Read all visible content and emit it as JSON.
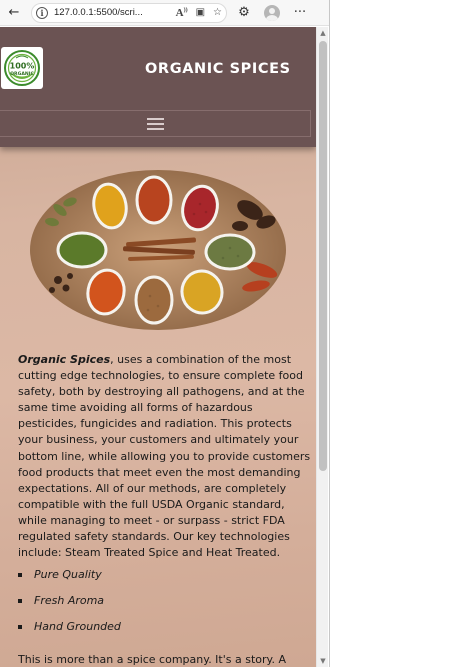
{
  "browser": {
    "url": "127.0.0.1:5500/scri...",
    "icons": {
      "back": "back-arrow-icon",
      "info": "info-icon",
      "reader": "read-aloud-icon",
      "immersive": "immersive-reader-icon",
      "favorite": "add-favorite-icon",
      "extensions": "extensions-icon",
      "profile": "profile-avatar-icon",
      "menu": "more-menu-icon"
    },
    "glyphs": {
      "back": "←",
      "info": "i",
      "reader": "Aᴬ",
      "immersive": "▣",
      "favorite": "☆",
      "extensions": "⚙",
      "menu": "···"
    }
  },
  "site": {
    "logo_top": "100%",
    "logo_bottom": "ORGANIC",
    "title": "ORGANIC SPICES",
    "colors": {
      "header": "#6b5353",
      "text": "#1a1a1a"
    }
  },
  "content": {
    "brand": "Organic Spices",
    "intro_rest": ", uses a combination of the most cutting edge technologies, to ensure complete food safety, both by destroying all pathogens, and at the same time avoiding all forms of hazardous pesticides, fungicides and radiation. This protects your business, your customers and ultimately your bottom line, while allowing you to provide customers food products that meet even the most demanding expectations. All of our methods, are completely compatible with the full USDA Organic standard, while managing to meet - or surpass - strict FDA regulated safety standards. Our key technologies include: Steam Treated Spice and Heat Treated.",
    "features": [
      "Pure Quality",
      "Fresh Aroma",
      "Hand Grounded"
    ],
    "story": "This is more than a spice company. It's a story. A"
  }
}
